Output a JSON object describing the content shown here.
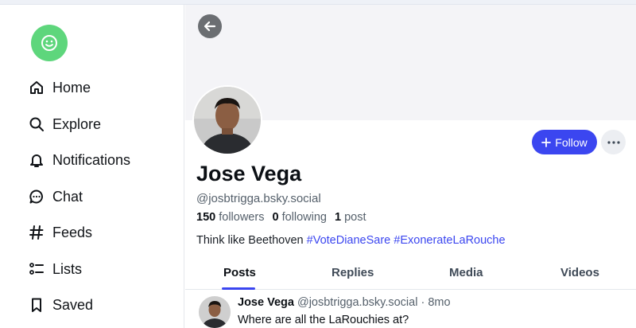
{
  "sidebar": {
    "items": [
      {
        "label": "Home",
        "icon": "home-icon"
      },
      {
        "label": "Explore",
        "icon": "search-icon"
      },
      {
        "label": "Notifications",
        "icon": "bell-icon"
      },
      {
        "label": "Chat",
        "icon": "chat-icon"
      },
      {
        "label": "Feeds",
        "icon": "hash-icon"
      },
      {
        "label": "Lists",
        "icon": "list-icon"
      },
      {
        "label": "Saved",
        "icon": "bookmark-icon"
      }
    ]
  },
  "profile": {
    "name": "Jose Vega",
    "handle": "@josbtrigga.bsky.social",
    "followers_count": "150",
    "followers_label": "followers",
    "following_count": "0",
    "following_label": "following",
    "posts_count": "1",
    "posts_label": "post",
    "bio_text": "Think like Beethoven",
    "bio_tags": [
      "#VoteDianeSare",
      "#ExonerateLaRouche"
    ],
    "follow_label": "Follow"
  },
  "tabs": [
    {
      "label": "Posts",
      "active": true
    },
    {
      "label": "Replies",
      "active": false
    },
    {
      "label": "Media",
      "active": false
    },
    {
      "label": "Videos",
      "active": false
    }
  ],
  "posts": [
    {
      "author": "Jose Vega",
      "handle": "@josbtrigga.bsky.social",
      "time": "· 8mo",
      "text": "Where are all the LaRouchies at?"
    }
  ],
  "colors": {
    "accent": "#3b46f0",
    "logo": "#5ed67c"
  }
}
